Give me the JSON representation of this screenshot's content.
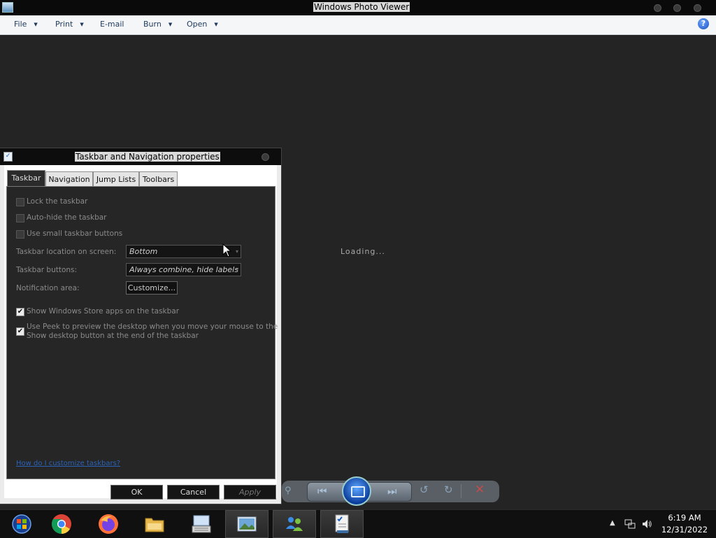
{
  "photo_viewer": {
    "title": "Windows Photo Viewer",
    "menu": [
      {
        "label": "File",
        "has_arrow": true
      },
      {
        "label": "Print",
        "has_arrow": true
      },
      {
        "label": "E-mail",
        "has_arrow": false
      },
      {
        "label": "Burn",
        "has_arrow": true
      },
      {
        "label": "Open",
        "has_arrow": true
      }
    ],
    "help_glyph": "?",
    "status": "Loading..."
  },
  "dialog": {
    "title": "Taskbar and Navigation properties",
    "tabs": [
      "Taskbar",
      "Navigation",
      "Jump Lists",
      "Toolbars"
    ],
    "selected_tab": "Taskbar",
    "checkboxes": {
      "lock": {
        "label": "Lock the taskbar",
        "checked": false
      },
      "autohide": {
        "label": "Auto-hide the taskbar",
        "checked": false
      },
      "small": {
        "label": "Use small taskbar buttons",
        "checked": false
      },
      "store": {
        "label": "Show Windows Store apps on the taskbar",
        "checked": true
      },
      "peek_line1": "Use Peek to preview the desktop when you move your mouse to the",
      "peek_line2": "Show desktop button at the end of the taskbar",
      "peek_checked": true
    },
    "location_label": "Taskbar location on screen:",
    "location_value": "Bottom",
    "buttons_label": "Taskbar buttons:",
    "buttons_value": "Always combine, hide labels",
    "notification_label": "Notification area:",
    "customize_label": "Customize...",
    "help_link": "How do I customize taskbars?",
    "ok_label": "OK",
    "cancel_label": "Cancel",
    "apply_label": "Apply"
  },
  "taskbar": {
    "apps": [
      "start-orb",
      "chrome",
      "firefox",
      "file-explorer",
      "on-screen-keyboard",
      "photo-viewer",
      "windows-live",
      "taskbar-properties"
    ],
    "active_apps": [
      "photo-viewer",
      "taskbar-properties"
    ],
    "time": "6:19 AM",
    "date": "12/31/2022"
  },
  "colors": {
    "window_bg": "#242424",
    "menu_bg": "#f5f6f8",
    "link": "#2b63b8",
    "accent_blue": "#1c4fbf"
  }
}
